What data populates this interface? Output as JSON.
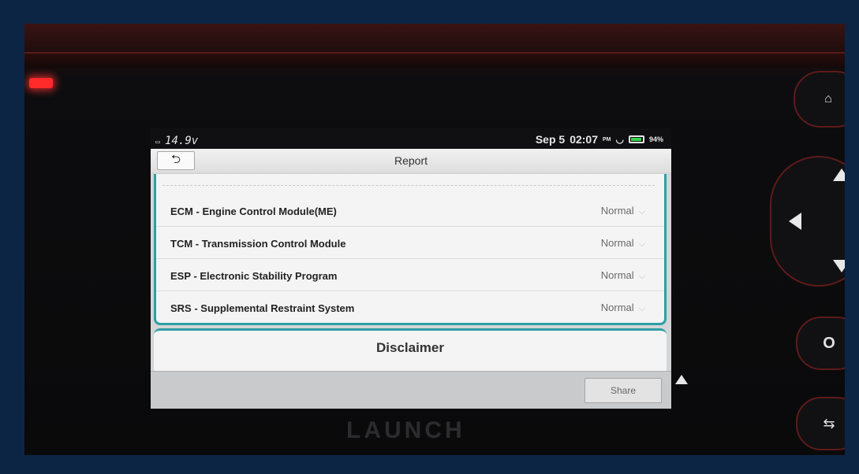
{
  "status_bar": {
    "voltage": "14.9v",
    "date": "Sep 5",
    "time": "02:07",
    "ampm": "PM",
    "battery": "94%"
  },
  "header": {
    "title": "Report"
  },
  "modules": [
    {
      "name": "ECM - Engine Control Module(ME)",
      "status": "Normal"
    },
    {
      "name": "TCM - Transmission Control Module",
      "status": "Normal"
    },
    {
      "name": "ESP - Electronic Stability Program",
      "status": "Normal"
    },
    {
      "name": "SRS - Supplemental Restraint System",
      "status": "Normal"
    }
  ],
  "disclaimer": {
    "label": "Disclaimer"
  },
  "footer": {
    "share_label": "Share"
  },
  "device": {
    "brand": "LAUNCH"
  },
  "colors": {
    "accent": "#2e9fa6",
    "bezel": "#0c2545",
    "led": "#ff2a2a"
  }
}
